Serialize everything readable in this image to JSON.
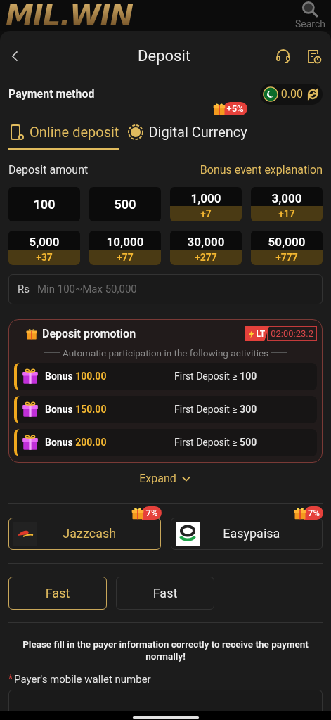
{
  "app_bar": {
    "logo": "MIL.WIN",
    "search_label": "Search"
  },
  "header": {
    "title": "Deposit"
  },
  "payment_method": {
    "label": "Payment method",
    "balance": "0.00"
  },
  "tabs": [
    {
      "label": "Online deposit",
      "selected": true
    },
    {
      "label": "Digital Currency",
      "selected": false,
      "badge": "+5%"
    }
  ],
  "deposit_amount": {
    "label": "Deposit amount",
    "link": "Bonus event explanation"
  },
  "amounts": [
    {
      "value": "100"
    },
    {
      "value": "500"
    },
    {
      "value": "1,000",
      "bonus": "+7"
    },
    {
      "value": "3,000",
      "bonus": "+17"
    },
    {
      "value": "5,000",
      "bonus": "+37"
    },
    {
      "value": "10,000",
      "bonus": "+77"
    },
    {
      "value": "30,000",
      "bonus": "+277"
    },
    {
      "value": "50,000",
      "bonus": "+777"
    }
  ],
  "amount_field": {
    "prefix": "Rs",
    "placeholder": "Min 100~Max 50,000"
  },
  "promotion": {
    "title": "Deposit promotion",
    "timer_tag": "LT",
    "timer": "02:00:23.2",
    "subtitle": "Automatic participation in the following activities",
    "items": [
      {
        "label": "Bonus",
        "amount": "100.00",
        "condition": "First Deposit ≥ **100**"
      },
      {
        "label": "Bonus",
        "amount": "150.00",
        "condition": "First Deposit ≥ **300**"
      },
      {
        "label": "Bonus",
        "amount": "200.00",
        "condition": "First Deposit ≥ **500**"
      }
    ]
  },
  "expand": "Expand",
  "methods": [
    {
      "kind": "jazzcash",
      "name": "Jazzcash",
      "badge": "7%",
      "selected": true
    },
    {
      "kind": "easypaisa",
      "name": "Easypaisa",
      "badge": "7%",
      "selected": false
    }
  ],
  "channels": [
    {
      "label": "Fast",
      "selected": true
    },
    {
      "label": "Fast",
      "selected": false
    }
  ],
  "notice": "Please fill in the payer information correctly to receive the payment normally!",
  "wallet_field": {
    "label": "Payer's mobile wallet number",
    "required_mark": "*"
  }
}
